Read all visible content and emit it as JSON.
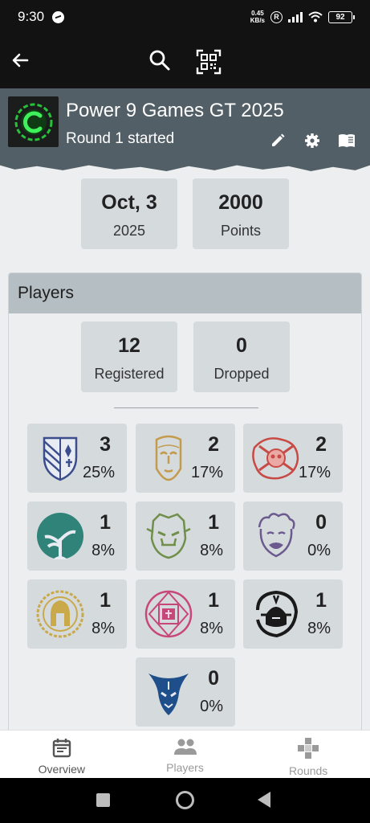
{
  "status_bar": {
    "time": "9:30",
    "net_speed_value": "0.45",
    "net_speed_unit": "KB/s",
    "battery": "92"
  },
  "event": {
    "title": "Power 9 Games GT 2025",
    "status": "Round 1 started"
  },
  "info_tiles": [
    {
      "big": "Oct, 3",
      "small": "2025"
    },
    {
      "big": "2000",
      "small": "Points"
    }
  ],
  "players": {
    "heading": "Players",
    "registered": {
      "value": "12",
      "label": "Registered"
    },
    "dropped": {
      "value": "0",
      "label": "Dropped"
    }
  },
  "factions": [
    {
      "icon": "heraldic-shield-icon",
      "count": "3",
      "percent": "25%",
      "color": "#3b4d8c"
    },
    {
      "icon": "stone-face-icon",
      "count": "2",
      "percent": "17%",
      "color": "#c49a4c"
    },
    {
      "icon": "bloody-skull-icon",
      "count": "2",
      "percent": "17%",
      "color": "#c84a45"
    },
    {
      "icon": "tree-moon-icon",
      "count": "1",
      "percent": "8%",
      "color": "#2f8378"
    },
    {
      "icon": "orc-face-icon",
      "count": "1",
      "percent": "8%",
      "color": "#6f8f4a"
    },
    {
      "icon": "bearded-face-icon",
      "count": "0",
      "percent": "0%",
      "color": "#6b5a8e"
    },
    {
      "icon": "spartan-helmet-icon",
      "count": "1",
      "percent": "8%",
      "color": "#c9a94a"
    },
    {
      "icon": "rune-circle-icon",
      "count": "1",
      "percent": "8%",
      "color": "#c8477a"
    },
    {
      "icon": "samurai-helmet-icon",
      "count": "1",
      "percent": "8%",
      "color": "#1a1a1a"
    },
    {
      "icon": "blue-demon-icon",
      "count": "0",
      "percent": "0%",
      "color": "#1f4f8a"
    }
  ],
  "bottom_nav": [
    {
      "label": "Overview",
      "icon": "calendar-icon"
    },
    {
      "label": "Players",
      "icon": "people-icon"
    },
    {
      "label": "Rounds",
      "icon": "rounds-icon"
    }
  ]
}
